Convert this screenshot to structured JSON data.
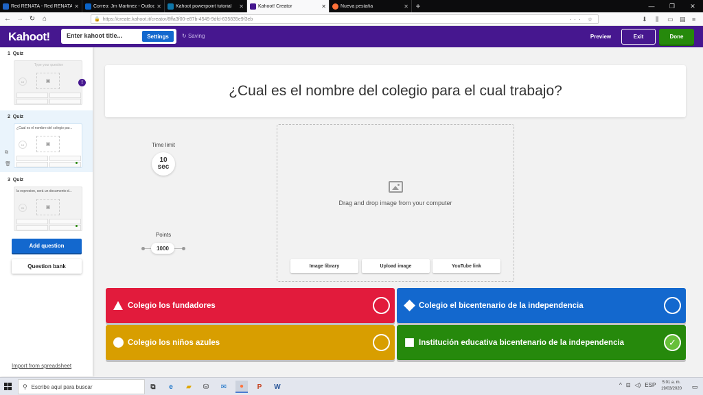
{
  "browser": {
    "tabs": [
      {
        "label": "Red RENATA - Red RENATA Red",
        "fav_color": "#1e63c4",
        "active": false
      },
      {
        "label": "Correo: Jm Martinez - Outlook",
        "fav_color": "#0a64c8",
        "active": false
      },
      {
        "label": "Kahoot powerpoint tutorial",
        "fav_color": "#0e76a8",
        "active": false
      },
      {
        "label": "Kahoot! Creator",
        "fav_color": "#46178f",
        "active": true
      },
      {
        "label": "Nueva pestaña",
        "fav_color": "#ff7139",
        "active": false
      }
    ],
    "url": "https://create.kahoot.it/creator/8ffa3f00-e87b-4549-9dfd-635835e9f3eb"
  },
  "header": {
    "logo": "Kahoot!",
    "title_placeholder": "Enter kahoot title...",
    "settings_label": "Settings",
    "saving_label": "Saving",
    "preview_label": "Preview",
    "exit_label": "Exit",
    "done_label": "Done"
  },
  "sidebar": {
    "questions": [
      {
        "number": "1",
        "type": "Quiz",
        "text": "Type your question",
        "time": "10"
      },
      {
        "number": "2",
        "type": "Quiz",
        "text": "¿Cual es el nombre del colegio par...",
        "time": "10"
      },
      {
        "number": "3",
        "type": "Quiz",
        "text": "la expresion, será un documento d...",
        "time": "20"
      }
    ],
    "add_question_label": "Add question",
    "question_bank_label": "Question bank",
    "import_label": "Import from spreadsheet"
  },
  "editor": {
    "question": "¿Cual es el nombre del colegio para el cual trabajo?",
    "time_limit_label": "Time limit",
    "time_value": "10",
    "time_unit": "sec",
    "points_label": "Points",
    "points_value": "1000",
    "drop_text": "Drag and drop image from your computer",
    "media_buttons": [
      "Image library",
      "Upload image",
      "YouTube link"
    ]
  },
  "answers": [
    {
      "text": "Colegio los fundadores",
      "color": "#e21b3c",
      "shape": "triangle",
      "correct": false
    },
    {
      "text": "Colegio el bicentenario de la independencia",
      "color": "#1368ce",
      "shape": "diamond",
      "correct": false
    },
    {
      "text": "Colegio los niños azules",
      "color": "#d89e00",
      "shape": "circle",
      "correct": false
    },
    {
      "text": "Institución educativa bicentenario de la independencia",
      "color": "#26890c",
      "shape": "square",
      "correct": true
    }
  ],
  "taskbar": {
    "search_placeholder": "Escribe aquí para buscar",
    "lang": "ESP",
    "time": "5:01 a. m.",
    "date": "19/03/2020"
  }
}
